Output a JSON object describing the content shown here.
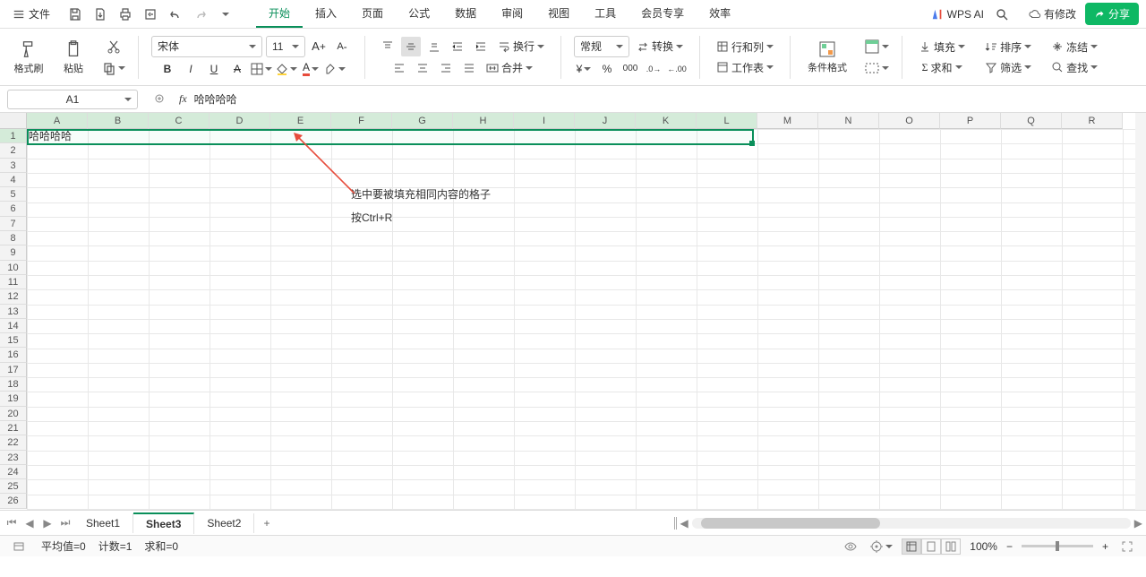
{
  "titlebar": {
    "file_label": "文件",
    "tabs": [
      "开始",
      "插入",
      "页面",
      "公式",
      "数据",
      "审阅",
      "视图",
      "工具",
      "会员专享",
      "效率"
    ],
    "active_tab": 0,
    "wps_ai": "WPS AI",
    "modified": "有修改",
    "share": "分享"
  },
  "ribbon": {
    "format_painter": "格式刷",
    "paste": "粘贴",
    "font_name": "宋体",
    "font_size": "11",
    "wrap": "换行",
    "merge": "合并",
    "number_format": "常规",
    "convert": "转换",
    "rowcol": "行和列",
    "worksheet": "工作表",
    "cond_format": "条件格式",
    "fill": "填充",
    "sort": "排序",
    "freeze": "冻结",
    "sum": "求和",
    "filter": "筛选",
    "find": "查找"
  },
  "namebox": {
    "cell": "A1",
    "formula": "哈哈哈哈"
  },
  "sheet": {
    "columns": [
      "A",
      "B",
      "C",
      "D",
      "E",
      "F",
      "G",
      "H",
      "I",
      "J",
      "K",
      "L",
      "M",
      "N",
      "O",
      "P",
      "Q",
      "R"
    ],
    "selected_cols": [
      "A",
      "B",
      "C",
      "D",
      "E",
      "F",
      "G",
      "H",
      "I",
      "J",
      "K",
      "L"
    ],
    "rows": 26,
    "selected_row": 1,
    "a1_value": "哈哈哈哈"
  },
  "annotation": {
    "line1": "选中要被填充相同内容的格子",
    "line2": "按Ctrl+R"
  },
  "tabbar": {
    "sheets": [
      "Sheet1",
      "Sheet3",
      "Sheet2"
    ],
    "active": 1
  },
  "statusbar": {
    "avg": "平均值=0",
    "count": "计数=1",
    "sum": "求和=0",
    "zoom": "100%"
  }
}
